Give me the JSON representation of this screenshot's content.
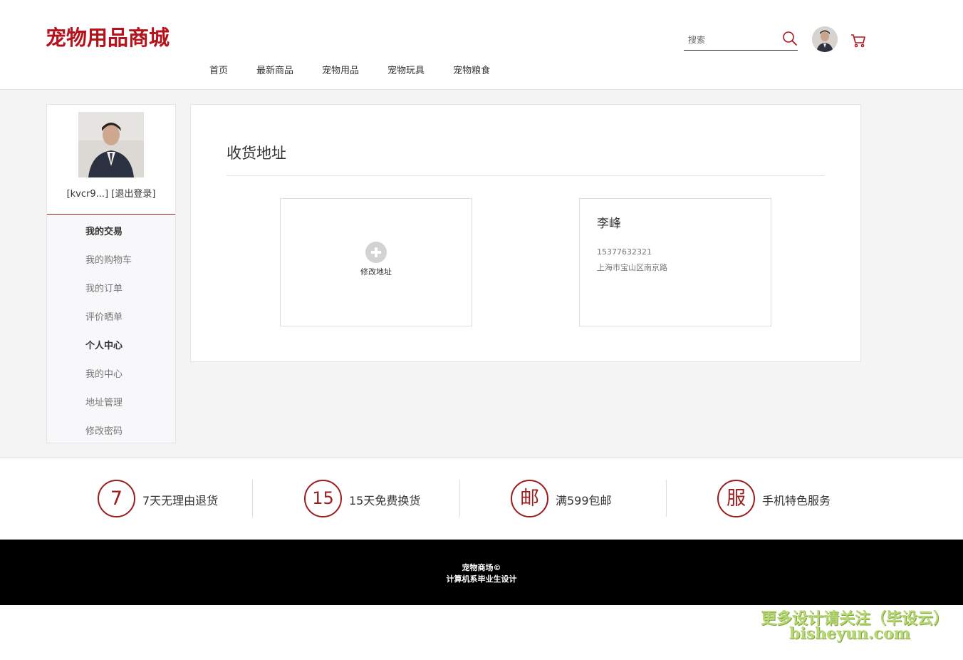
{
  "header": {
    "logo": "宠物用品商城",
    "search_placeholder": "搜索",
    "icons": {
      "search": "search-icon",
      "cart": "cart-icon",
      "avatar": "user-avatar"
    },
    "accent_color": "#b5121b"
  },
  "nav": {
    "items": [
      {
        "label": "首页"
      },
      {
        "label": "最新商品"
      },
      {
        "label": "宠物用品"
      },
      {
        "label": "宠物玩具"
      },
      {
        "label": "宠物粮食"
      }
    ]
  },
  "sidebar": {
    "username": "[kvcr9...]",
    "logout": "[退出登录]",
    "menu": [
      {
        "label": "我的交易",
        "type": "heading"
      },
      {
        "label": "我的购物车",
        "type": "link"
      },
      {
        "label": "我的订单",
        "type": "link"
      },
      {
        "label": "评价晒单",
        "type": "link"
      },
      {
        "label": "个人中心",
        "type": "heading"
      },
      {
        "label": "我的中心",
        "type": "link"
      },
      {
        "label": "地址管理",
        "type": "link"
      },
      {
        "label": "修改密码",
        "type": "link"
      }
    ]
  },
  "main": {
    "title": "收货地址",
    "add_card": {
      "label": "修改地址",
      "icon": "plus-circle-icon"
    },
    "address_card": {
      "name": "李峰",
      "phone": "15377632321",
      "address": "上海市宝山区南京路"
    }
  },
  "services": [
    {
      "badge": "7",
      "text": "7天无理由退货"
    },
    {
      "badge": "15",
      "text": "15天免费换货"
    },
    {
      "badge": "邮",
      "text": "满599包邮"
    },
    {
      "badge": "服",
      "text": "手机特色服务"
    }
  ],
  "footer": {
    "line1": "宠物商场©",
    "line2": "计算机系毕业生设计"
  },
  "watermark": {
    "line1": "更多设计请关注（毕设云）",
    "line2": "bisheyun.com"
  }
}
